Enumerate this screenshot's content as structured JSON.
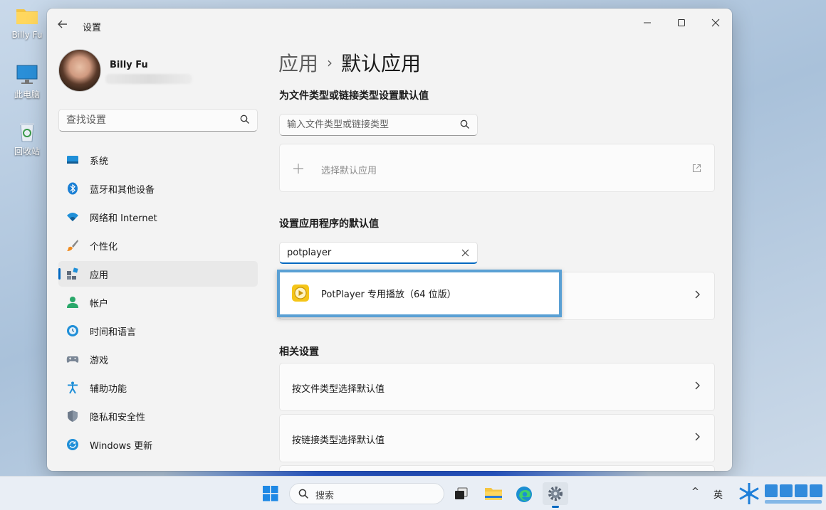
{
  "desktop": {
    "icons": [
      {
        "label": "Billy Fu"
      },
      {
        "label": "此电脑"
      },
      {
        "label": "回收站"
      }
    ]
  },
  "window": {
    "title": "设置",
    "controls": {
      "minimize": "—",
      "maximize": "☐",
      "close": "✕"
    }
  },
  "profile": {
    "name": "Billy Fu"
  },
  "sidebar": {
    "search_placeholder": "查找设置",
    "items": [
      {
        "label": "系统",
        "icon": "system-icon",
        "active": false
      },
      {
        "label": "蓝牙和其他设备",
        "icon": "bluetooth-icon",
        "active": false
      },
      {
        "label": "网络和 Internet",
        "icon": "wifi-icon",
        "active": false
      },
      {
        "label": "个性化",
        "icon": "brush-icon",
        "active": false
      },
      {
        "label": "应用",
        "icon": "apps-icon",
        "active": true
      },
      {
        "label": "帐户",
        "icon": "account-icon",
        "active": false
      },
      {
        "label": "时间和语言",
        "icon": "clock-globe-icon",
        "active": false
      },
      {
        "label": "游戏",
        "icon": "gamepad-icon",
        "active": false
      },
      {
        "label": "辅助功能",
        "icon": "accessibility-icon",
        "active": false
      },
      {
        "label": "隐私和安全性",
        "icon": "shield-icon",
        "active": false
      },
      {
        "label": "Windows 更新",
        "icon": "update-icon",
        "active": false
      }
    ]
  },
  "main": {
    "breadcrumb": {
      "parent": "应用",
      "separator": "›",
      "current": "默认应用"
    },
    "file_types_section": {
      "heading": "为文件类型或链接类型设置默认值",
      "search_placeholder": "输入文件类型或链接类型",
      "choose_app_label": "选择默认应用"
    },
    "apps_section": {
      "heading": "设置应用程序的默认值",
      "search_value": "potplayer",
      "result_label": "PotPlayer 专用播放（64 位版）"
    },
    "related_section": {
      "heading": "相关设置",
      "items": [
        {
          "label": "按文件类型选择默认值"
        },
        {
          "label": "按链接类型选择默认值"
        }
      ]
    }
  },
  "taskbar": {
    "search_label": "搜索",
    "lang_label": "英",
    "tray_chevron": "^"
  },
  "colors": {
    "accent": "#0067c0",
    "highlight_border": "#5aa0d4",
    "window_bg": "#f3f3f3",
    "potplayer_yellow": "#f5c518"
  }
}
